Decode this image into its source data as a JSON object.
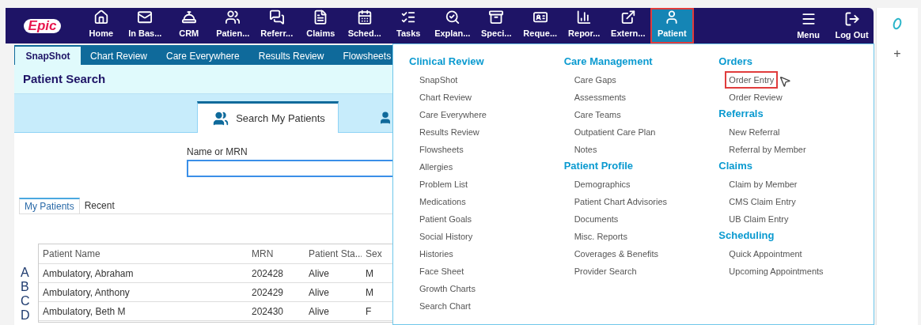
{
  "header": {
    "logo": "Epic",
    "nav": [
      {
        "label": "Home",
        "selected": false,
        "annotated": false
      },
      {
        "label": "In Bas...",
        "selected": false,
        "annotated": false
      },
      {
        "label": "CRM",
        "selected": false,
        "annotated": false
      },
      {
        "label": "Patien...",
        "selected": false,
        "annotated": false
      },
      {
        "label": "Referr...",
        "selected": false,
        "annotated": false
      },
      {
        "label": "Claims",
        "selected": false,
        "annotated": false
      },
      {
        "label": "Sched...",
        "selected": false,
        "annotated": false
      },
      {
        "label": "Tasks",
        "selected": false,
        "annotated": false
      },
      {
        "label": "Explan...",
        "selected": false,
        "annotated": false
      },
      {
        "label": "Speci...",
        "selected": false,
        "annotated": false
      },
      {
        "label": "Reque...",
        "selected": false,
        "annotated": false
      },
      {
        "label": "Repor...",
        "selected": false,
        "annotated": false
      },
      {
        "label": "Extern...",
        "selected": false,
        "annotated": false
      },
      {
        "label": "Patient",
        "selected": true,
        "annotated": true
      }
    ],
    "right_nav": [
      {
        "label": "Menu"
      },
      {
        "label": "Log Out"
      }
    ]
  },
  "activity_tabs": [
    {
      "label": "SnapShot",
      "selected": true
    },
    {
      "label": "Chart Review",
      "selected": false
    },
    {
      "label": "Care Everywhere",
      "selected": false
    },
    {
      "label": "Results Review",
      "selected": false
    },
    {
      "label": "Flowsheets",
      "selected": false
    }
  ],
  "page_title": "Patient Search",
  "search_tabs": [
    {
      "label": "Search My Patients",
      "selected": true
    }
  ],
  "search_field": {
    "label": "Name or MRN"
  },
  "list_tabs": [
    {
      "label": "My Patients",
      "selected": true
    },
    {
      "label": "Recent",
      "selected": false
    }
  ],
  "alphabet": [
    "A",
    "B",
    "C",
    "D"
  ],
  "table": {
    "columns": [
      "Patient Name",
      "MRN",
      "Patient Sta...",
      "Sex"
    ],
    "rows": [
      [
        "Ambulatory, Abraham",
        "202428",
        "Alive",
        "M"
      ],
      [
        "Ambulatory, Anthony",
        "202429",
        "Alive",
        "M"
      ],
      [
        "Ambulatory, Beth M",
        "202430",
        "Alive",
        "F"
      ]
    ]
  },
  "side_panel": {
    "add": "+"
  },
  "patient_menu": {
    "columns": [
      [
        {
          "heading": "Clinical Review",
          "items": [
            {
              "label": "SnapShot",
              "annotated": false
            },
            {
              "label": "Chart Review",
              "annotated": false
            },
            {
              "label": "Care Everywhere",
              "annotated": false
            },
            {
              "label": "Results Review",
              "annotated": false
            },
            {
              "label": "Flowsheets",
              "annotated": false
            },
            {
              "label": "Allergies",
              "annotated": false
            },
            {
              "label": "Problem List",
              "annotated": false
            },
            {
              "label": "Medications",
              "annotated": false
            },
            {
              "label": "Patient Goals",
              "annotated": false
            },
            {
              "label": "Social History",
              "annotated": false
            },
            {
              "label": "Histories",
              "annotated": false
            },
            {
              "label": "Face Sheet",
              "annotated": false
            },
            {
              "label": "Growth Charts",
              "annotated": false
            },
            {
              "label": "Search Chart",
              "annotated": false
            }
          ]
        }
      ],
      [
        {
          "heading": "Care Management",
          "items": [
            {
              "label": "Care Gaps",
              "annotated": false
            },
            {
              "label": "Assessments",
              "annotated": false
            },
            {
              "label": "Care Teams",
              "annotated": false
            },
            {
              "label": "Outpatient Care Plan",
              "annotated": false
            },
            {
              "label": "Notes",
              "annotated": false
            }
          ]
        },
        {
          "heading": "Patient Profile",
          "items": [
            {
              "label": "Demographics",
              "annotated": false
            },
            {
              "label": "Patient Chart Advisories",
              "annotated": false
            },
            {
              "label": "Documents",
              "annotated": false
            },
            {
              "label": "Misc. Reports",
              "annotated": false
            },
            {
              "label": "Coverages & Benefits",
              "annotated": false
            },
            {
              "label": "Provider Search",
              "annotated": false
            }
          ]
        }
      ],
      [
        {
          "heading": "Orders",
          "items": [
            {
              "label": "Order Entry",
              "annotated": true
            },
            {
              "label": "Order Review",
              "annotated": false
            }
          ]
        },
        {
          "heading": "Referrals",
          "items": [
            {
              "label": "New Referral",
              "annotated": false
            },
            {
              "label": "Referral by Member",
              "annotated": false
            }
          ]
        },
        {
          "heading": "Claims",
          "items": [
            {
              "label": "Claim by Member",
              "annotated": false
            },
            {
              "label": "CMS Claim Entry",
              "annotated": false
            },
            {
              "label": "UB Claim Entry",
              "annotated": false
            }
          ]
        },
        {
          "heading": "Scheduling",
          "items": [
            {
              "label": "Quick Appointment",
              "annotated": false
            },
            {
              "label": "Upcoming Appointments",
              "annotated": false
            }
          ]
        }
      ]
    ]
  }
}
